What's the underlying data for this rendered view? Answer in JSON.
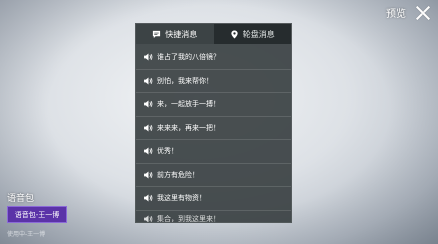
{
  "header": {
    "preview_label": "预览"
  },
  "tabs": [
    {
      "label": "快捷消息",
      "icon": "chat-bubble-icon",
      "active": true
    },
    {
      "label": "轮盘消息",
      "icon": "location-pin-icon",
      "active": false
    }
  ],
  "messages": [
    "谁占了我的八倍镜？",
    "别怕，我来帮你！",
    "来，一起放手一搏！",
    "来来来，再来一把！",
    "优秀！",
    "前方有危险！",
    "我这里有物资！",
    "集合，到我这里来！"
  ],
  "voice_pack": {
    "title": "语音包",
    "selected": "语音包-王一博",
    "subtitle": "使用中-王一博"
  },
  "colors": {
    "voice_pack_accent": "#5b33a8",
    "panel_bg": "#3a4042"
  }
}
